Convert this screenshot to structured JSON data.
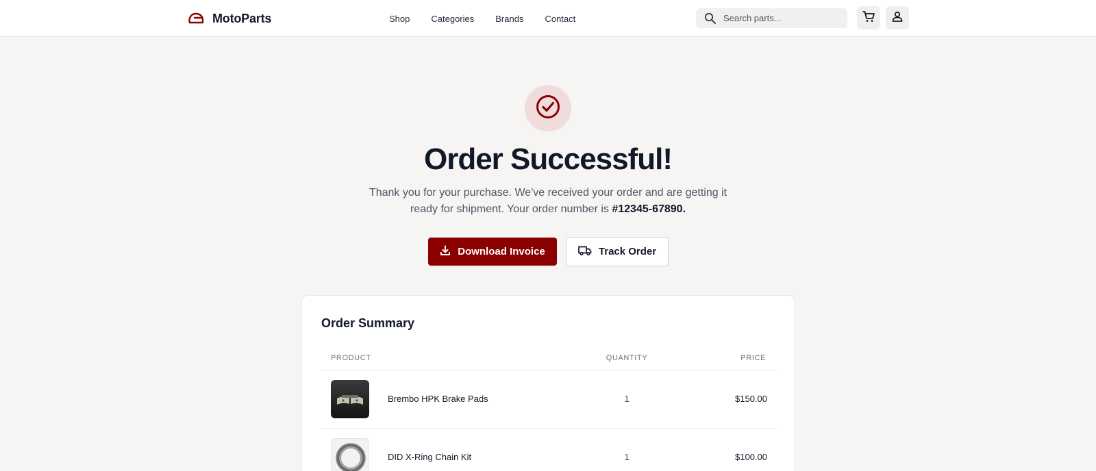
{
  "header": {
    "brand": "MotoParts",
    "nav": [
      "Shop",
      "Categories",
      "Brands",
      "Contact"
    ],
    "search_placeholder": "Search parts...",
    "icons": {
      "brand": "helmet-icon",
      "search": "search-icon",
      "cart": "cart-icon",
      "user": "user-icon"
    }
  },
  "hero": {
    "icon": "check-circle-icon",
    "title": "Order Successful!",
    "message": "Thank you for your purchase. We've received your order and are getting it ready for shipment. Your order number is",
    "order_number": "#12345-67890.",
    "primary_button": "Download Invoice",
    "secondary_button": "Track Order"
  },
  "summary": {
    "title": "Order Summary",
    "columns": [
      "PRODUCT",
      "QUANTITY",
      "PRICE"
    ],
    "rows": [
      {
        "name": "Brembo HPK Brake Pads",
        "quantity": "1",
        "price": "$150.00",
        "thumb": "brake-pads-image"
      },
      {
        "name": "DID X-Ring Chain Kit",
        "quantity": "1",
        "price": "$100.00",
        "thumb": "chain-kit-image"
      }
    ]
  },
  "colors": {
    "accent": "#8b0000",
    "accent_soft": "#f0dcdc",
    "background": "#f6f5f4",
    "text": "#111827"
  }
}
